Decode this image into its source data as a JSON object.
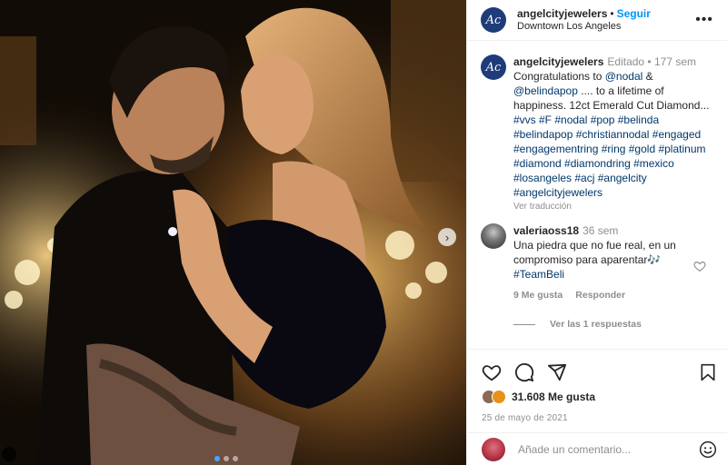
{
  "post": {
    "username": "angelcityjewelers",
    "logo_text": "Ac",
    "follow_label": "Seguir",
    "location": "Downtown Los Angeles"
  },
  "caption": {
    "username": "angelcityjewelers",
    "edited": "Editado",
    "age": "177 sem",
    "text_a": "Congratulations to ",
    "mention_1": "@nodal",
    "text_b": " & ",
    "mention_2": "@belindapop",
    "text_c": " .... to a lifetime of happiness. 12ct Emerald Cut Diamond... ",
    "hashtags": "#vvs #F #nodal #pop #belinda #belindapop #christiannodal #engaged #engagementring #ring #gold #platinum #diamond #diamondring #mexico #losangeles #acj #angelcity #angelcityjewelers",
    "translate": "Ver traducción"
  },
  "comment": {
    "username": "valeriaoss18",
    "age": "36 sem",
    "text": "Una piedra que no fue real, en un compromiso para aparentar🎶",
    "hashtag": "#TeamBeli",
    "likes": "9 Me gusta",
    "reply": "Responder",
    "view_replies": "Ver las 1 respuestas"
  },
  "stats": {
    "likes": "31.608 Me gusta",
    "date": "25 de mayo de 2021"
  },
  "composer": {
    "placeholder": "Añade un comentario..."
  },
  "icons": {
    "like": "heart-icon",
    "comment": "comment-bubble-icon",
    "share": "paper-plane-icon",
    "save": "bookmark-icon",
    "emoji": "smiley-icon",
    "more": "more-dots-icon",
    "next": "chevron-right-icon"
  },
  "colors": {
    "follow": "#0095f6",
    "logo_bg": "#1e3b7a",
    "tag": "#00376b"
  }
}
